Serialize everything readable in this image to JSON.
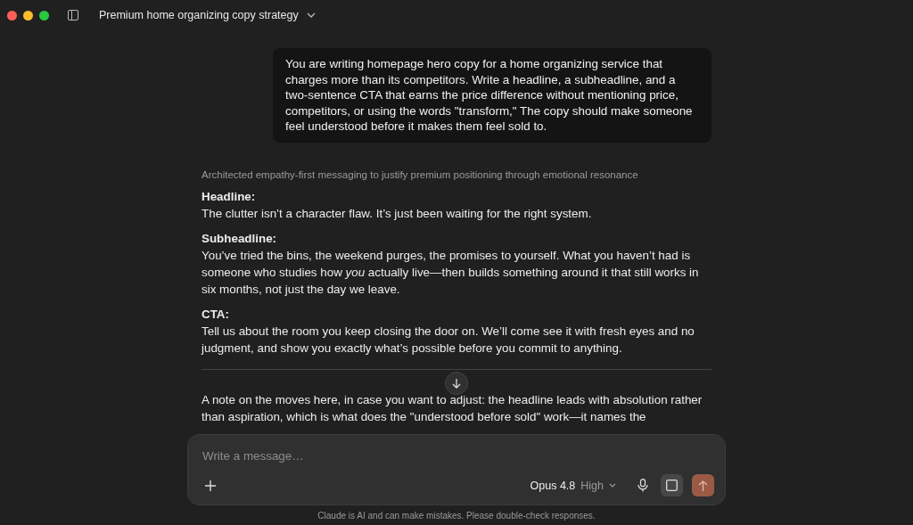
{
  "window": {
    "title": "Premium home organizing copy strategy"
  },
  "user_message": "You are writing homepage hero copy for a home organizing service that charges more than its competitors. Write a headline, a subheadline, and a two-sentence CTA that earns the price difference without mentioning price, competitors, or using the words \"transform,\" The copy should make someone feel understood before it makes them feel sold to.",
  "thinking_summary": "Architected empathy-first messaging to justify premium positioning through emotional resonance",
  "sections": [
    {
      "heading": "Headline:",
      "body": "The clutter isn’t a character flaw. It’s just been waiting for the right system."
    },
    {
      "heading": "Subheadline:",
      "body": "You’ve tried the bins, the weekend purges, the promises to yourself. What you haven’t had is someone who studies how *you* actually live—then builds something around it that still works in six months, not just the day we leave."
    },
    {
      "heading": "CTA:",
      "body": "Tell us about the room you keep closing the door on. We’ll come see it with fresh eyes and no judgment, and show you exactly what’s possible before you commit to anything."
    }
  ],
  "note": "A note on the moves here, in case you want to adjust: the headline leads with absolution rather than aspiration, which is what does the \"understood before sold\" work—it names the",
  "composer": {
    "placeholder": "Write a message…",
    "model": "Opus 4.8",
    "effort": "High"
  },
  "disclaimer": "Claude is AI and can make mistakes. Please double-check responses."
}
